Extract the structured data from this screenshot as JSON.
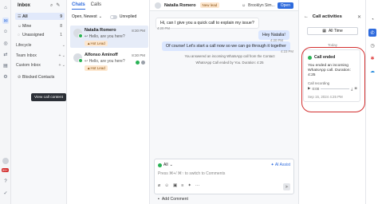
{
  "colors": {
    "accent": "#2f6bdd",
    "whatsapp_green": "#29b255",
    "lead_bg": "#fde7cf",
    "highlight_red": "#d32f2f"
  },
  "rail": {
    "badge": "99+"
  },
  "inbox": {
    "title": "Inbox",
    "items": [
      {
        "label": "All",
        "count": "9"
      },
      {
        "label": "Mine",
        "count": "8"
      },
      {
        "label": "Unassigned",
        "count": "1"
      }
    ],
    "sections": [
      "Lifecycle",
      "Team Inbox",
      "Custom Inbox"
    ],
    "blocked": "Blocked Contacts"
  },
  "chats": {
    "tab_chats": "Chats",
    "tab_calls": "Calls",
    "sort": "Open, Newest",
    "unreplied": "Unreplied",
    "list": [
      {
        "name": "Natalia Romero",
        "time": "8:30 PM",
        "msg": "Hello, are you here?",
        "tag": "Hot Lead"
      },
      {
        "name": "Alfonso Aminoff",
        "time": "8:30 PM",
        "msg": "Hello, are you here?",
        "tag": "Hot Lead"
      }
    ]
  },
  "conversation": {
    "name": "Natalia Romero",
    "tag": "New lead",
    "assignee": "Brooklyn Sim...",
    "status": "Open",
    "messages": {
      "m1": "Hi, can I give you a quick call to explain my issue?",
      "m1_time": "4:20 PM",
      "m2": "Hey Natalia!",
      "m2_time": "4:20 PM",
      "m3": "Of course! Let's start a call now so we can go through it together",
      "m3_time": "4:23 PM"
    },
    "system": [
      "You answered an incoming WhatsApp call from the Contact",
      "WhatsApp Call ended by You. Duration: 4:25"
    ],
    "composer": {
      "channel": "All",
      "ai_assist": "AI Assist",
      "placeholder": "Press ⌘+/ ⌘↑ to switch to Comments"
    },
    "add_comment": "Add Comment"
  },
  "activities": {
    "title": "Call activities",
    "filter": "All Time",
    "today": "Today",
    "card": {
      "title": "Call ended",
      "body": "You ended an incoming WhatsApp call. Duration: 4:25",
      "recording_label": "Call recording",
      "position": "0:00",
      "date": "Sep 15, 2024 4:25 PM"
    },
    "tooltip": "View call content"
  }
}
